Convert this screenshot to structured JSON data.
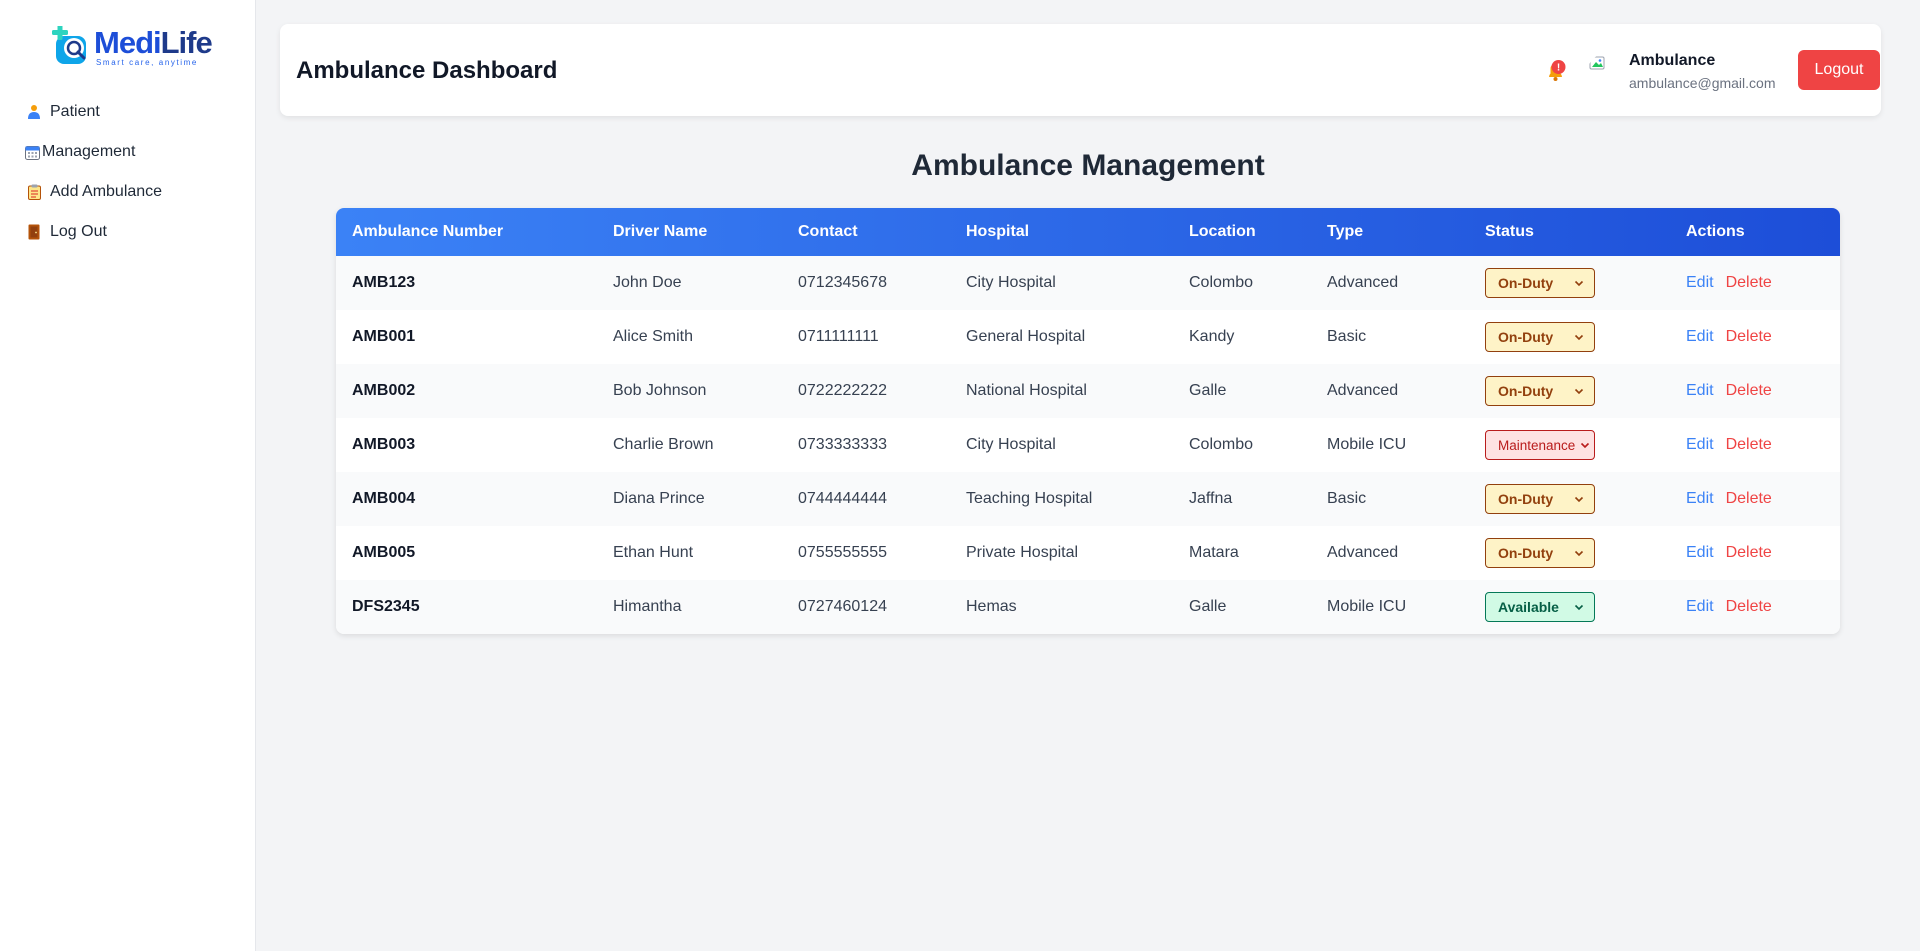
{
  "app": {
    "logo_title": "MediLife",
    "logo_tagline": "Smart care, anytime"
  },
  "sidebar": {
    "items": [
      {
        "label": "Patient",
        "icon": "patient-icon"
      },
      {
        "label": "Management",
        "icon": "calendar-icon"
      },
      {
        "label": "Add Ambulance",
        "icon": "clipboard-icon"
      },
      {
        "label": "Log Out",
        "icon": "door-icon"
      }
    ]
  },
  "header": {
    "title": "Ambulance Dashboard",
    "notification_badge": "!",
    "avatar_alt": "User",
    "user_name": "Ambulance",
    "user_email": "ambulance@gmail.com",
    "logout_label": "Logout"
  },
  "main": {
    "title": "Ambulance Management",
    "columns": [
      "Ambulance Number",
      "Driver Name",
      "Contact",
      "Hospital",
      "Location",
      "Type",
      "Status",
      "Actions"
    ],
    "edit_label": "Edit",
    "delete_label": "Delete",
    "rows": [
      {
        "number": "AMB123",
        "driver": "John Doe",
        "contact": "0712345678",
        "hospital": "City Hospital",
        "location": "Colombo",
        "type": "Advanced",
        "status": "On-Duty"
      },
      {
        "number": "AMB001",
        "driver": "Alice Smith",
        "contact": "0711111111",
        "hospital": "General Hospital",
        "location": "Kandy",
        "type": "Basic",
        "status": "On-Duty"
      },
      {
        "number": "AMB002",
        "driver": "Bob Johnson",
        "contact": "0722222222",
        "hospital": "National Hospital",
        "location": "Galle",
        "type": "Advanced",
        "status": "On-Duty"
      },
      {
        "number": "AMB003",
        "driver": "Charlie Brown",
        "contact": "0733333333",
        "hospital": "City Hospital",
        "location": "Colombo",
        "type": "Mobile ICU",
        "status": "Maintenance"
      },
      {
        "number": "AMB004",
        "driver": "Diana Prince",
        "contact": "0744444444",
        "hospital": "Teaching Hospital",
        "location": "Jaffna",
        "type": "Basic",
        "status": "On-Duty"
      },
      {
        "number": "AMB005",
        "driver": "Ethan Hunt",
        "contact": "0755555555",
        "hospital": "Private Hospital",
        "location": "Matara",
        "type": "Advanced",
        "status": "On-Duty"
      },
      {
        "number": "DFS2345",
        "driver": "Himantha",
        "contact": "0727460124",
        "hospital": "Hemas",
        "location": "Galle",
        "type": "Mobile ICU",
        "status": "Available"
      }
    ]
  },
  "colors": {
    "header_gradient_start": "#3b82f6",
    "header_gradient_end": "#1d4ed8",
    "logout_bg": "#ef4444",
    "on_duty_bg": "#fef3c7",
    "maintenance_bg": "#fee2e2",
    "available_bg": "#d1fae5"
  }
}
